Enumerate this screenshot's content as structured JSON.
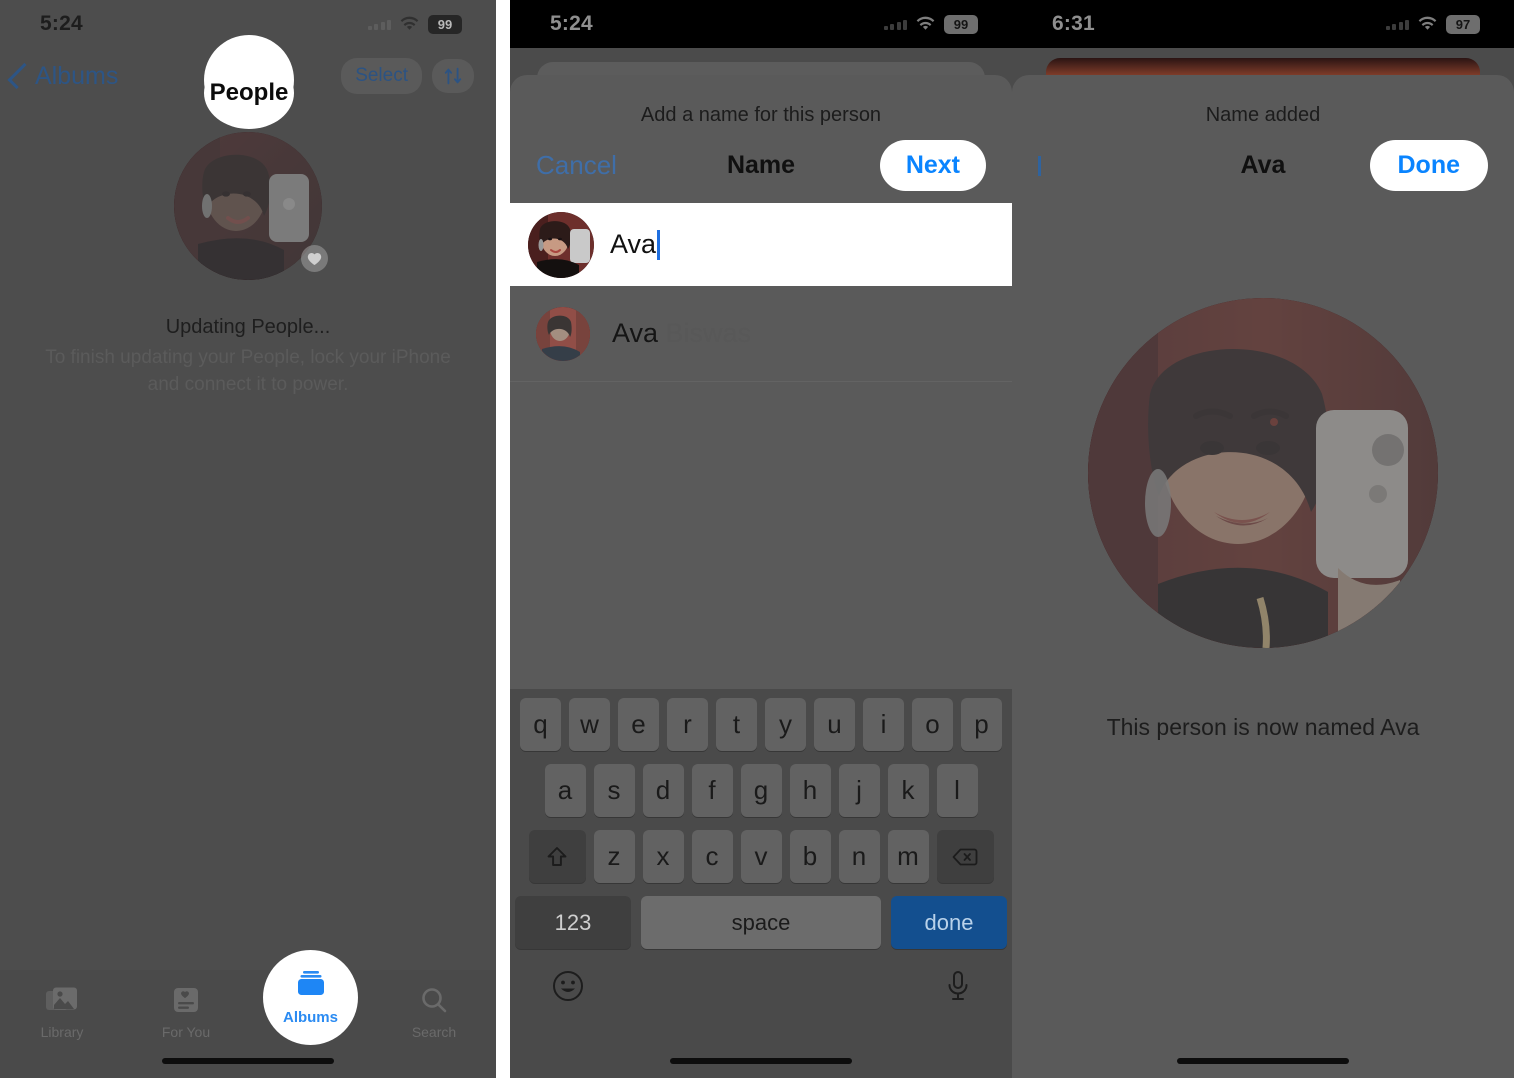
{
  "panel1": {
    "status": {
      "time": "5:24",
      "battery": "99",
      "wifi_icon": "wifi-icon",
      "signal_icon": "signal-dots-icon"
    },
    "nav": {
      "back_label": "Albums",
      "back_icon": "chevron-left-icon",
      "title": "People",
      "select_label": "Select",
      "sort_icon": "sort-arrows-icon"
    },
    "person": {
      "favorite_icon": "heart-icon",
      "avatar": "person-avatar"
    },
    "status_message": {
      "heading": "Updating People...",
      "body": "To finish updating your People, lock your iPhone and connect it to power."
    },
    "tabs": [
      {
        "label": "Library",
        "icon": "photo-stack-icon",
        "active": false
      },
      {
        "label": "For You",
        "icon": "for-you-card-icon",
        "active": false
      },
      {
        "label": "Albums",
        "icon": "albums-icon",
        "active": true
      },
      {
        "label": "Search",
        "icon": "search-icon",
        "active": false
      }
    ]
  },
  "panel2": {
    "status": {
      "time": "5:24",
      "battery": "99",
      "wifi_icon": "wifi-icon",
      "signal_icon": "signal-dots-icon"
    },
    "sheet": {
      "subtitle": "Add a name for this person",
      "cancel_label": "Cancel",
      "title": "Name",
      "next_label": "Next"
    },
    "input": {
      "value": "Ava",
      "placeholder": "Name",
      "avatar": "person-avatar"
    },
    "suggestion": {
      "first": "Ava",
      "last": " Biswas",
      "avatar": "contact-avatar"
    },
    "keyboard": {
      "row1": [
        "q",
        "w",
        "e",
        "r",
        "t",
        "y",
        "u",
        "i",
        "o",
        "p"
      ],
      "row2": [
        "a",
        "s",
        "d",
        "f",
        "g",
        "h",
        "j",
        "k",
        "l"
      ],
      "row3": [
        "z",
        "x",
        "c",
        "v",
        "b",
        "n",
        "m"
      ],
      "shift_icon": "shift-up-arrow-icon",
      "delete_icon": "backspace-icon",
      "numbers_label": "123",
      "space_label": "space",
      "done_label": "done",
      "emoji_icon": "emoji-smiley-icon",
      "mic_icon": "microphone-icon"
    }
  },
  "panel3": {
    "status": {
      "time": "6:31",
      "battery": "97",
      "wifi_icon": "wifi-icon",
      "signal_icon": "signal-dots-icon"
    },
    "sheet": {
      "subtitle": "Name added",
      "back_icon": "chevron-left-icon",
      "title": "Ava",
      "done_label": "Done"
    },
    "caption": "This person is now named Ava",
    "avatar": "person-avatar-large"
  },
  "colors": {
    "accent_blue": "#0a84ff",
    "link_blue": "#2d5585",
    "sheet_gray": "#5a5a5a",
    "panel_gray": "#4d4d4d",
    "done_key_blue": "#134f8f"
  }
}
